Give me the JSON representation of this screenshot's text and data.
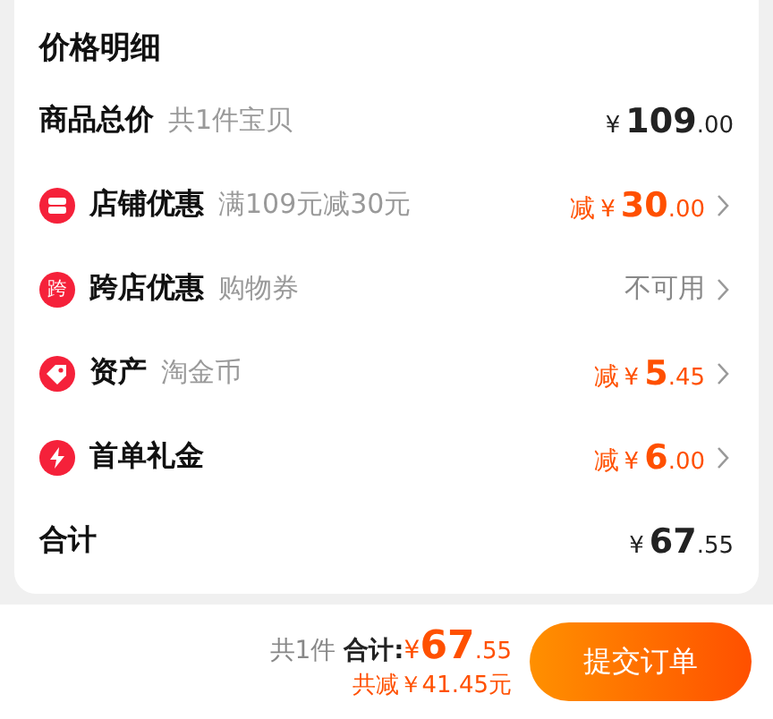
{
  "title": "价格明细",
  "rows": [
    {
      "kind": "plain",
      "label": "商品总价",
      "note": "共1件宝贝",
      "currency": "¥",
      "integer": "109",
      "decimal": ".00"
    },
    {
      "kind": "discount",
      "label": "店铺优惠",
      "note": "满109元减30元",
      "prefix": "减",
      "currency": "¥",
      "integer": "30",
      "decimal": ".00"
    },
    {
      "kind": "unavailable",
      "icon_text": "跨",
      "label": "跨店优惠",
      "note": "购物券",
      "status": "不可用"
    },
    {
      "kind": "discount",
      "label": "资产",
      "note": "淘金币",
      "prefix": "减",
      "currency": "¥",
      "integer": "5",
      "decimal": ".45"
    },
    {
      "kind": "discount",
      "label": "首单礼金",
      "prefix": "减",
      "currency": "¥",
      "integer": "6",
      "decimal": ".00"
    },
    {
      "kind": "plain",
      "label": "合计",
      "currency": "¥",
      "integer": "67",
      "decimal": ".55"
    }
  ],
  "footer": {
    "count": "共1件",
    "total_label": "合计:",
    "currency": "¥",
    "integer": "67",
    "decimal": ".55",
    "saved": "共减￥41.45元",
    "submit": "提交订单"
  }
}
